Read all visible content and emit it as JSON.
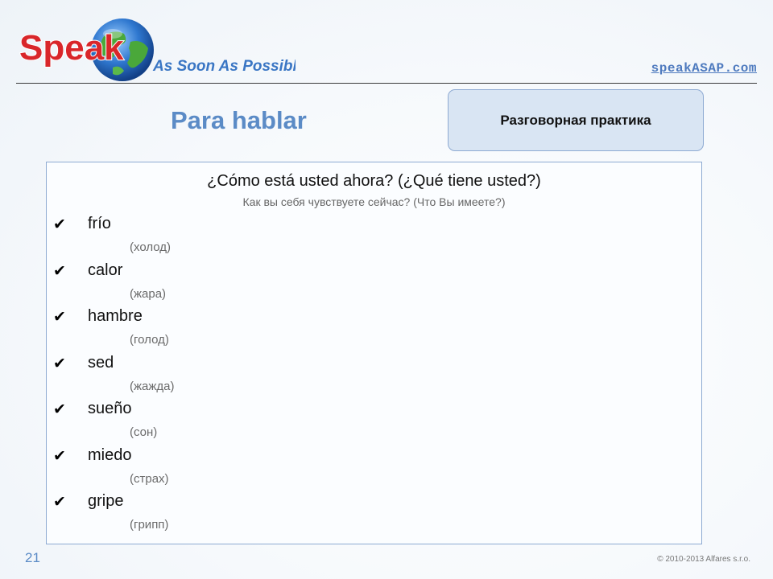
{
  "header": {
    "logo_word": "Speak",
    "logo_tagline": "As Soon As Possible",
    "site_link": "speakASAP.com"
  },
  "slide": {
    "title": "Para hablar",
    "practice_label": "Разговорная практика",
    "question": "¿Cómo está usted ahora? (¿Qué tiene usted?)",
    "question_translation": "Как вы себя чувствуете сейчас? (Что Вы имеете?)",
    "vocabulary": [
      {
        "term": "frío",
        "translation": "(холод)"
      },
      {
        "term": "calor",
        "translation": "(жара)"
      },
      {
        "term": "hambre",
        "translation": "(голод)"
      },
      {
        "term": "sed",
        "translation": "(жажда)"
      },
      {
        "term": "sueño",
        "translation": "(сон)"
      },
      {
        "term": "miedo",
        "translation": "(страх)"
      },
      {
        "term": "gripe",
        "translation": "(грипп)"
      }
    ]
  },
  "footer": {
    "slide_number": "21",
    "copyright": "© 2010-2013 Alfares s.r.o."
  },
  "colors": {
    "accent": "#5b8bc6",
    "logo_red": "#d9262a",
    "logo_blue": "#3a76c4",
    "box_fill": "#d9e5f3",
    "box_border": "#8eaad2"
  },
  "icons": {
    "check": "checkmark-icon",
    "logo": "globe-icon"
  }
}
